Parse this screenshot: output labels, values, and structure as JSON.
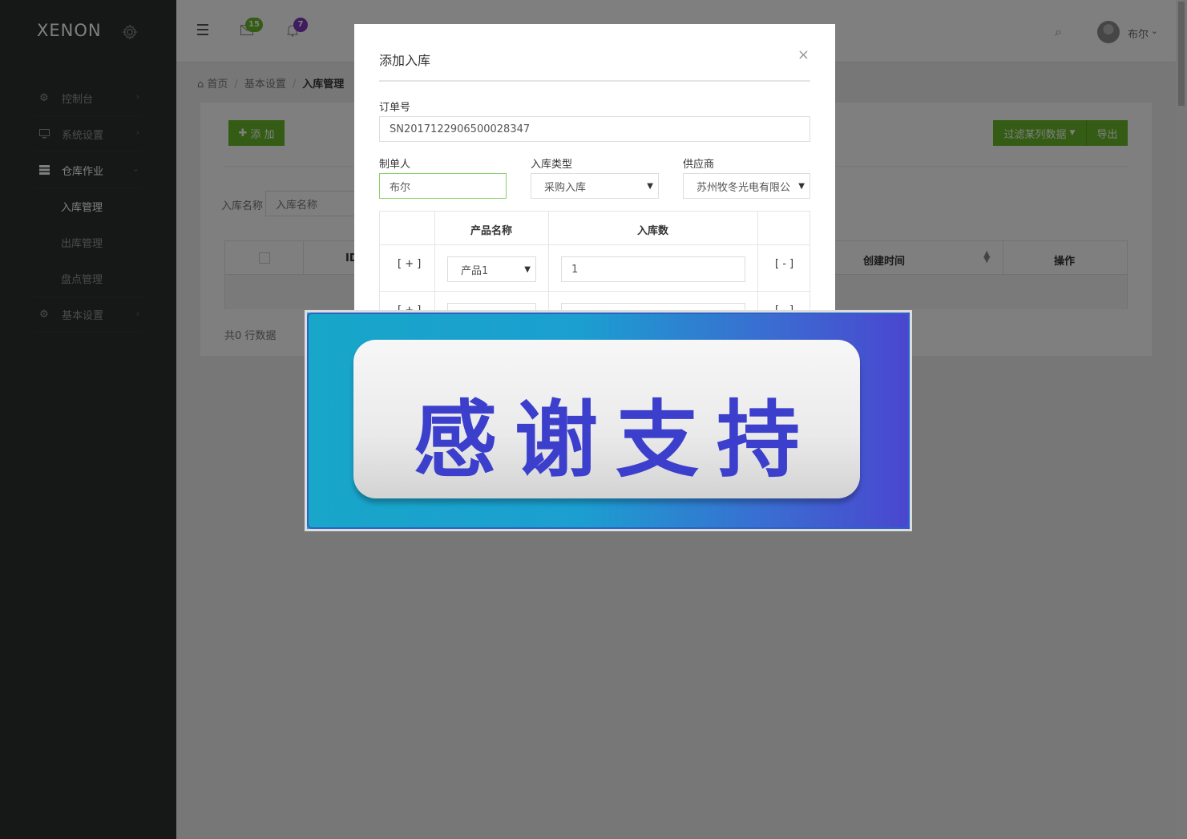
{
  "app": {
    "logo": "XENON"
  },
  "sidebar": {
    "items": [
      {
        "label": "控制台",
        "icon": "gear-icon"
      },
      {
        "label": "系统设置",
        "icon": "monitor-icon"
      },
      {
        "label": "仓库作业",
        "icon": "storage-icon",
        "expanded": true
      },
      {
        "label": "基本设置",
        "icon": "gear-icon"
      }
    ],
    "subitems": [
      {
        "label": "入库管理",
        "current": true
      },
      {
        "label": "出库管理"
      },
      {
        "label": "盘点管理"
      }
    ]
  },
  "topbar": {
    "mail_count": "15",
    "bell_count": "7",
    "user_name": "布尔",
    "colors": {
      "mail_badge": "#68b828",
      "bell_badge": "#7c38bc"
    }
  },
  "breadcrumb": {
    "home": "首页",
    "section": "基本设置",
    "current": "入库管理"
  },
  "panel": {
    "add_label": "添 加",
    "filter_label": "过滤某列数据",
    "export_label": "导出",
    "search_label": "入库名称",
    "search_placeholder": "入库名称",
    "columns": {
      "id": "ID",
      "created": "创建时间",
      "op": "操作"
    },
    "footer": "共0 行数据"
  },
  "modal": {
    "title": "添加入库",
    "close": "×",
    "order_label": "订单号",
    "order_value": "SN2017122906500028347",
    "maker_label": "制单人",
    "maker_value": "布尔",
    "type_label": "入库类型",
    "type_value": "采购入库",
    "supplier_label": "供应商",
    "supplier_value": "苏州牧冬光电有限公",
    "table": {
      "col_product": "产品名称",
      "col_qty": "入库数",
      "rows": [
        {
          "add": "[ + ]",
          "product": "产品1",
          "qty": "1",
          "remove": "[ - ]"
        },
        {
          "add": "[ + ]",
          "product": "",
          "qty": "",
          "remove": "[ - ]"
        }
      ]
    }
  },
  "banner": {
    "text": "感谢支持"
  },
  "colors": {
    "accent": "#68b828",
    "sidebar": "#2c2e2f",
    "banner_text": "#3b3fcc"
  }
}
